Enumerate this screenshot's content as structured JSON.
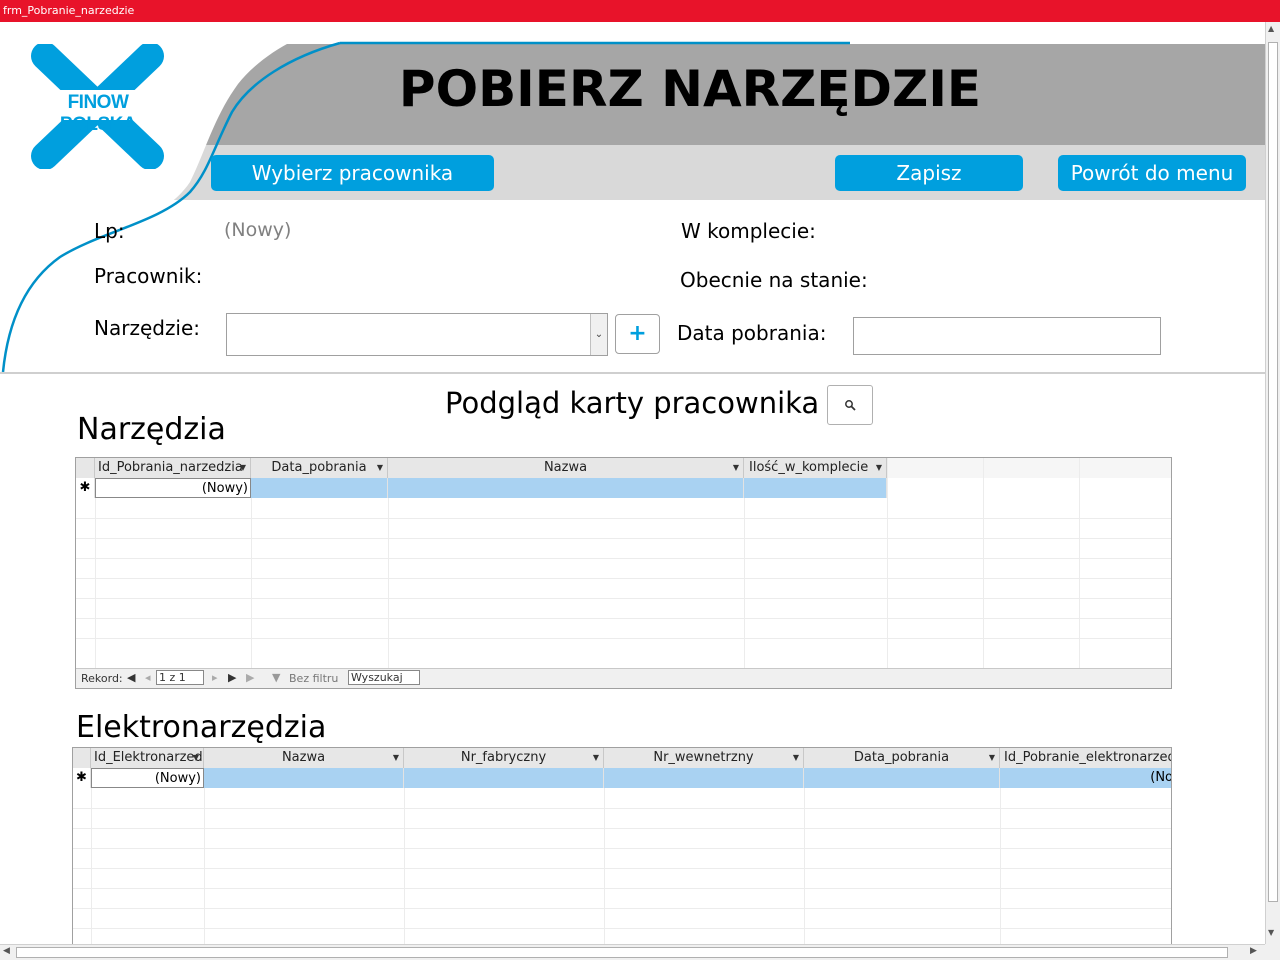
{
  "window": {
    "title": "frm_Pobranie_narzedzie"
  },
  "logo": {
    "text": "FINOW POLSKA",
    "color": "#009fde"
  },
  "header": {
    "title": "POBIERZ NARZĘDZIE"
  },
  "buttons": {
    "select_employee": "Wybierz pracownika",
    "save": "Zapisz",
    "back_menu": "Powrót do menu",
    "add": "+"
  },
  "form": {
    "lp_label": "Lp:",
    "lp_value": "(Nowy)",
    "employee_label": "Pracownik:",
    "tool_label": "Narzędzie:",
    "tool_value": "",
    "in_set_label": "W komplecie:",
    "in_stock_label": "Obecnie na stanie:",
    "date_label": "Data pobrania:",
    "date_value": ""
  },
  "preview": {
    "label": "Podgląd karty pracownika",
    "icon": "magnifier-icon"
  },
  "tools_section": {
    "title": "Narzędzia",
    "columns": [
      "Id_Pobrania_narzedzia",
      "Data_pobrania",
      "Nazwa",
      "Ilość_w_komplecie"
    ],
    "new_row": "(Nowy)",
    "nav": {
      "record_label": "Rekord:",
      "position": "1 z 1",
      "filter": "Bez filtru",
      "search": "Wyszukaj"
    }
  },
  "electro_section": {
    "title": "Elektronarzędzia",
    "columns": [
      "Id_Elektronarzedzia",
      "Nazwa",
      "Nr_fabryczny",
      "Nr_wewnetrzny",
      "Data_pobrania",
      "Id_Pobranie_elektronarzedzia"
    ],
    "new_row": "(Nowy)",
    "last_cell": "(No"
  },
  "colors": {
    "titlebar": "#e8132a",
    "accent": "#009fde",
    "header_dark": "#a6a6a6",
    "header_light": "#d9d9d9",
    "row_selected": "#a9d2f2"
  }
}
